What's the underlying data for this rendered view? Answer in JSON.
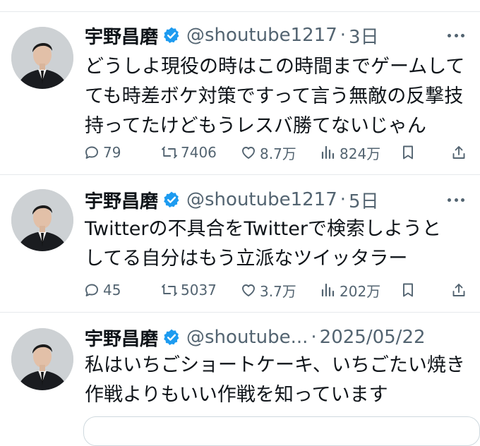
{
  "tweets": [
    {
      "display_name": "宇野昌磨",
      "handle": "@shoutube1217",
      "separator": "·",
      "time": "3日",
      "lines": [
        "どうしよ現役の時はこの時間までゲームして",
        "ても時差ボケ対策ですって言う無敵の反撃技",
        "持ってたけどもうレスバ勝てないじゃん"
      ],
      "replies": "79",
      "retweets": "7406",
      "likes": "8.7万",
      "views": "824万"
    },
    {
      "display_name": "宇野昌磨",
      "handle": "@shoutube1217",
      "separator": "·",
      "time": "5日",
      "lines": [
        "Twitterの不具合をTwitterで検索しようと",
        "してる自分はもう立派なツイッタラー"
      ],
      "replies": "45",
      "retweets": "5037",
      "likes": "3.7万",
      "views": "202万"
    },
    {
      "display_name": "宇野昌磨",
      "handle": "@shoutube...",
      "separator": "·",
      "time": "2025/05/22",
      "lines": [
        "私はいちごショートケーキ、いちごたい焼き",
        "作戦よりもいい作戦を知っています"
      ]
    }
  ],
  "icons": {
    "verified": "verified-badge-icon",
    "more": "more-options-icon",
    "reply": "reply-icon",
    "retweet": "retweet-icon",
    "like": "like-icon",
    "views": "views-icon",
    "bookmark": "bookmark-icon",
    "share": "share-icon"
  },
  "colors": {
    "verified_blue": "#1d9bf0",
    "secondary_text": "#536471",
    "primary_text": "#0f1419",
    "divider": "#e6e9ec"
  }
}
